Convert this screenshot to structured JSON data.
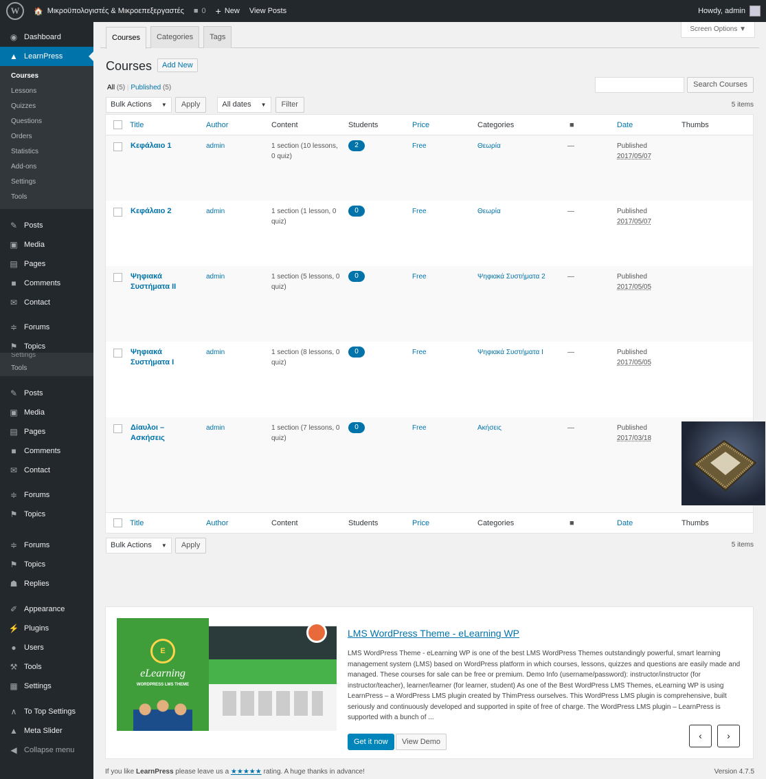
{
  "adminbar": {
    "site_name": "Μικροϋπολογιστές & Μικροεπεξεργαστές",
    "comments_count": "0",
    "new_label": "New",
    "view_posts": "View Posts",
    "howdy": "Howdy, admin"
  },
  "sidebar": {
    "top_items": [
      {
        "label": "Dashboard",
        "icon": "dashboard-icon"
      },
      {
        "label": "LearnPress",
        "icon": "graduation-cap-icon"
      }
    ],
    "learnpress_submenu": [
      "Courses",
      "Lessons",
      "Quizzes",
      "Questions",
      "Orders",
      "Statistics",
      "Add-ons",
      "Settings",
      "Tools"
    ],
    "group1": [
      "Posts",
      "Media",
      "Pages",
      "Comments",
      "Contact"
    ],
    "group2": [
      "Forums",
      "Topics"
    ],
    "overlap_text": "Settings",
    "overlap_tools": "Tools",
    "group3": [
      "Posts",
      "Media",
      "Pages",
      "Comments",
      "Contact"
    ],
    "group4": [
      "Forums",
      "Topics"
    ],
    "group5": [
      "Forums",
      "Topics",
      "Replies"
    ],
    "group6": [
      "Appearance",
      "Plugins",
      "Users",
      "Tools",
      "Settings"
    ],
    "group7": [
      "To Top Settings",
      "Meta Slider",
      "Collapse menu"
    ]
  },
  "tabs": [
    "Courses",
    "Categories",
    "Tags"
  ],
  "screen_options": "Screen Options ▼",
  "page_title": "Courses",
  "add_new": "Add New",
  "views": {
    "all": "All",
    "all_count": "(5)",
    "sep": "|",
    "published": "Published",
    "published_count": "(5)"
  },
  "search": {
    "button": "Search Courses",
    "placeholder": ""
  },
  "tablenav_top": {
    "bulk": "Bulk Actions",
    "apply": "Apply",
    "dates": "All dates",
    "filter": "Filter",
    "count": "5 items"
  },
  "tablenav_bottom": {
    "bulk": "Bulk Actions",
    "apply": "Apply",
    "count": "5 items"
  },
  "columns": [
    "Title",
    "Author",
    "Content",
    "Students",
    "Price",
    "Categories",
    "Date",
    "Thumbs"
  ],
  "rows": [
    {
      "title": "Κεφάλαιο 1",
      "author": "admin",
      "content": "1 section (10 lessons, 0 quiz)",
      "students": "2",
      "price": "Free",
      "category": "Θεωρία",
      "comments": "—",
      "status": "Published",
      "date": "2017/05/07"
    },
    {
      "title": "Κεφάλαιο 2",
      "author": "admin",
      "content": "1 section (1 lesson, 0 quiz)",
      "students": "0",
      "price": "Free",
      "category": "Θεωρία",
      "comments": "—",
      "status": "Published",
      "date": "2017/05/07"
    },
    {
      "title": "Ψηφιακά Συστήματα ΙΙ",
      "author": "admin",
      "content": "1 section (5 lessons, 0 quiz)",
      "students": "0",
      "price": "Free",
      "category": "Ψηφιακά Συστήματα 2",
      "comments": "—",
      "status": "Published",
      "date": "2017/05/05"
    },
    {
      "title": "Ψηφιακά Συστήματα Ι",
      "author": "admin",
      "content": "1 section (8 lessons, 0 quiz)",
      "students": "0",
      "price": "Free",
      "category": "Ψηφιακά Συστήματα Ι",
      "comments": "—",
      "status": "Published",
      "date": "2017/05/05"
    },
    {
      "title": "Δίαυλοι – Ασκήσεις",
      "author": "admin",
      "content": "1 section (7 lessons, 0 quiz)",
      "students": "0",
      "price": "Free",
      "category": "Ακήσεις",
      "comments": "—",
      "status": "Published",
      "date": "2017/03/18"
    }
  ],
  "promo": {
    "title": "LMS WordPress Theme - eLearning WP",
    "text": "LMS WordPress Theme - eLearning WP is one of the best LMS WordPress Themes outstandingly powerful, smart learning management system (LMS) based on WordPress platform in which courses, lessons, quizzes and questions are easily made and managed. These courses for sale can be free or premium. Demo Info (username/password): instructor/instructor (for instructor/teacher), learner/learner (for learner, student) As one of the Best WordPress LMS Themes, eLearning WP is using LearnPress – a WordPress LMS plugin created by ThimPress ourselves. This WordPress LMS plugin is comprehensive, built seriously and continuously developed and supported in spite of free of charge. The WordPress LMS plugin – LearnPress is supported with a bunch of ...",
    "get_it": "Get it now",
    "view_demo": "View Demo",
    "img_brand": "eLearning",
    "img_sub": "WORDPRESS LMS THEME"
  },
  "footer": {
    "prefix": "If you like ",
    "brand": "LearnPress",
    "mid": " please leave us a ",
    "stars": "★★★★★",
    "suffix": " rating. A huge thanks in advance!"
  },
  "version": "Version 4.7.5"
}
